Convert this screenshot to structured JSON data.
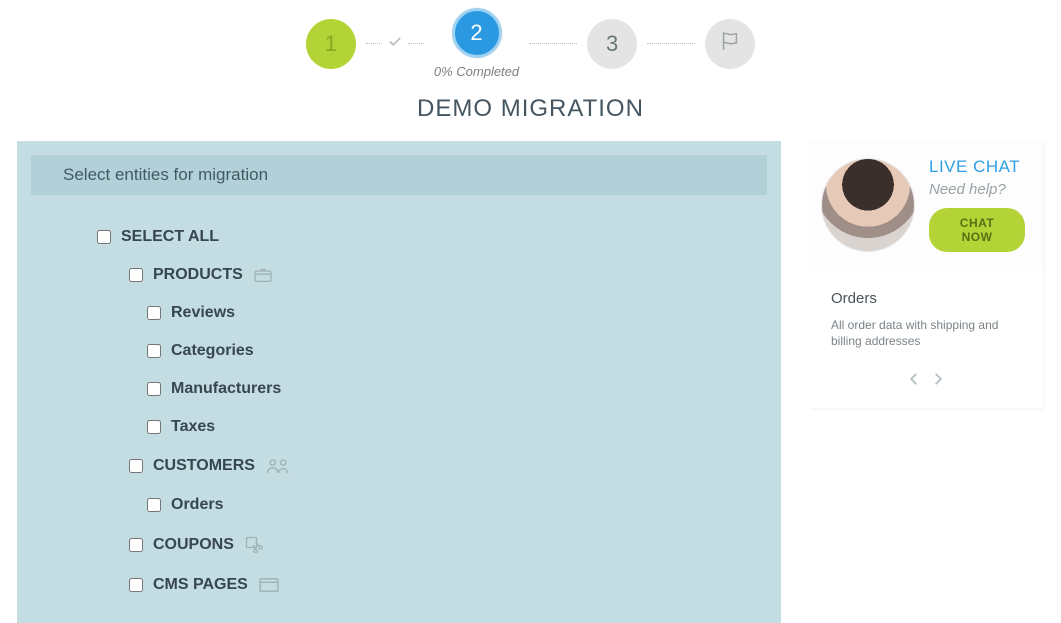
{
  "stepper": {
    "s1": "1",
    "s2": "2",
    "s3": "3",
    "completed": "0% Completed"
  },
  "title": "DEMO MIGRATION",
  "panel": {
    "heading": "Select entities for migration",
    "select_all": "SELECT ALL",
    "products": "PRODUCTS",
    "reviews": "Reviews",
    "categories": "Categories",
    "manufacturers": "Manufacturers",
    "taxes": "Taxes",
    "customers": "CUSTOMERS",
    "orders": "Orders",
    "coupons": "COUPONS",
    "cms_pages": "CMS PAGES"
  },
  "chat": {
    "title": "LIVE CHAT",
    "sub": "Need help?",
    "button": "CHAT NOW"
  },
  "info": {
    "title": "Orders",
    "desc": "All order data with shipping and billing addresses"
  }
}
